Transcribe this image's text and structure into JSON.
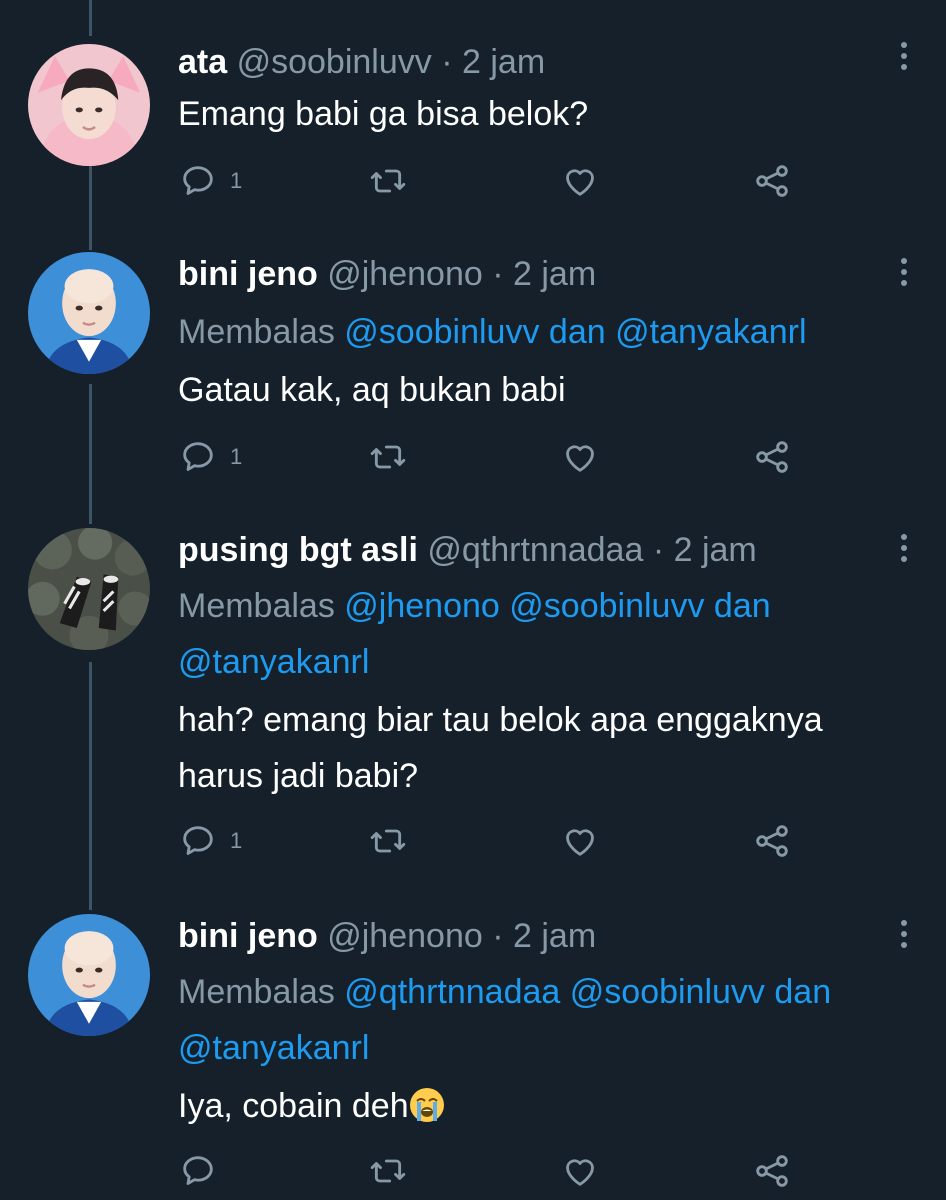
{
  "tweets": [
    {
      "display_name": "ata",
      "handle": "@soobinluvv",
      "separator": "·",
      "time": "2 jam",
      "replying_prefix": "",
      "mentions": [],
      "replying_joiner": "",
      "body_lines": [
        "Emang babi ga bisa belok?"
      ],
      "reply_count": "1",
      "avatar": "avatar-pink-hoodie"
    },
    {
      "display_name": "bini jeno",
      "handle": "@jhenono",
      "separator": "·",
      "time": "2 jam",
      "replying_prefix": "Membalas",
      "mentions": [
        "@soobinluvv",
        "@tanyakanrl"
      ],
      "replying_joiner": "dan",
      "body_lines": [
        "Gatau kak, aq bukan babi"
      ],
      "reply_count": "1",
      "avatar": "avatar-bald-person"
    },
    {
      "display_name": "pusing bgt asli",
      "handle": "@qthrtnnadaa",
      "separator": "·",
      "time": "2 jam",
      "replying_prefix": "Membalas",
      "mentions": [
        "@jhenono",
        "@soobinluvv",
        "@tanyakanrl"
      ],
      "replying_joiner": "dan",
      "body_lines": [
        "hah? emang biar tau belok apa enggaknya",
        "harus jadi babi?"
      ],
      "reply_count": "1",
      "avatar": "avatar-sneakers"
    },
    {
      "display_name": "bini jeno",
      "handle": "@jhenono",
      "separator": "·",
      "time": "2 jam",
      "replying_prefix": "Membalas",
      "mentions": [
        "@qthrtnnadaa",
        "@soobinluvv",
        "@tanyakanrl"
      ],
      "replying_joiner": "dan",
      "body_lines": [
        "Iya, cobain deh"
      ],
      "body_emoji": "loudly-crying-face-emoji",
      "reply_count": "",
      "avatar": "avatar-bald-person"
    }
  ],
  "icons": {
    "reply": "reply-icon",
    "retweet": "retweet-icon",
    "like": "like-icon",
    "share": "share-icon",
    "more": "more-vertical-icon"
  },
  "colors": {
    "background": "#15202b",
    "text": "#ffffff",
    "muted": "#8899a6",
    "link": "#1d9bf0",
    "thread_line": "#3d5466"
  }
}
